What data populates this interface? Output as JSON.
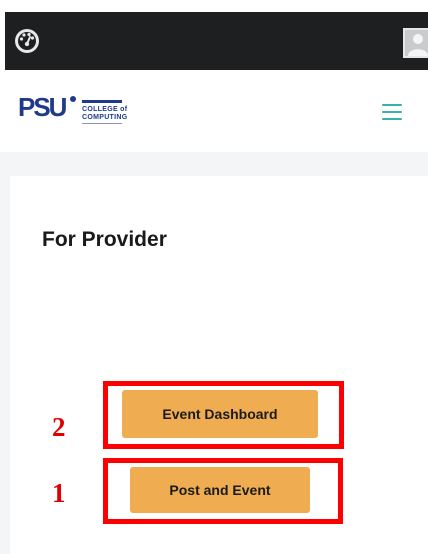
{
  "admin_bar": {
    "dashboard_icon": "dashboard-gauge-icon",
    "avatar_icon": "user-avatar-icon"
  },
  "header": {
    "logo": {
      "mark": "PSU",
      "line1": "COLLEGE of",
      "line2": "COMPUTING"
    },
    "menu_icon": "hamburger-menu-icon"
  },
  "main": {
    "title": "For Provider",
    "buttons": [
      {
        "label": "Event Dashboard"
      },
      {
        "label": "Post and Event"
      }
    ],
    "annotations": [
      {
        "number": "2"
      },
      {
        "number": "1"
      }
    ]
  },
  "colors": {
    "admin_bar": "#1e1f21",
    "button": "#f0ac50",
    "highlight": "#ff0000",
    "menu_icon": "#36b3a8",
    "brand": "#1f3a8a"
  }
}
